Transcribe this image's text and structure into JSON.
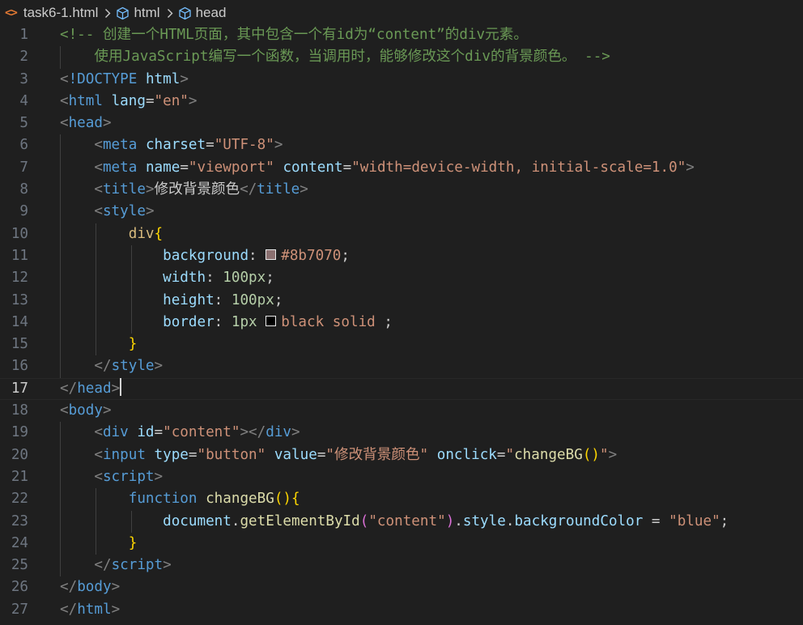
{
  "breadcrumb": {
    "file_icon": "<>",
    "file_name": "task6-1.html",
    "items": [
      "html",
      "head"
    ]
  },
  "icons": {
    "file": "html-file-icon",
    "element": "cube-icon",
    "separator": "chevron-right-icon"
  },
  "colors": {
    "background": "#1f1f1f",
    "swatch_rust": "#8b7070",
    "swatch_black": "#000000"
  },
  "editor": {
    "current_line": 17,
    "line_numbers": [
      "1",
      "2",
      "3",
      "4",
      "5",
      "6",
      "7",
      "8",
      "9",
      "10",
      "11",
      "12",
      "13",
      "14",
      "15",
      "16",
      "17",
      "18",
      "19",
      "20",
      "21",
      "22",
      "23",
      "24",
      "25",
      "26",
      "27"
    ],
    "lines": [
      [
        [
          "cm",
          "<!-- 创建一个HTML页面，其中包含一个有id为“content”的div元素。"
        ]
      ],
      [
        [
          "cm",
          "    使用JavaScript编写一个函数，当调用时，能够修改这个div的背景颜色。 -->"
        ]
      ],
      [
        [
          "br",
          "<"
        ],
        [
          "tag",
          "!DOCTYPE"
        ],
        [
          "text",
          " "
        ],
        [
          "attr",
          "html"
        ],
        [
          "br",
          ">"
        ]
      ],
      [
        [
          "br",
          "<"
        ],
        [
          "tag",
          "html"
        ],
        [
          "text",
          " "
        ],
        [
          "attr",
          "lang"
        ],
        [
          "text",
          "="
        ],
        [
          "str",
          "\"en\""
        ],
        [
          "br",
          ">"
        ]
      ],
      [
        [
          "br",
          "<"
        ],
        [
          "tag",
          "head"
        ],
        [
          "br",
          ">"
        ]
      ],
      [
        [
          "text",
          "    "
        ],
        [
          "br",
          "<"
        ],
        [
          "tag",
          "meta"
        ],
        [
          "text",
          " "
        ],
        [
          "attr",
          "charset"
        ],
        [
          "text",
          "="
        ],
        [
          "str",
          "\"UTF-8\""
        ],
        [
          "br",
          ">"
        ]
      ],
      [
        [
          "text",
          "    "
        ],
        [
          "br",
          "<"
        ],
        [
          "tag",
          "meta"
        ],
        [
          "text",
          " "
        ],
        [
          "attr",
          "name"
        ],
        [
          "text",
          "="
        ],
        [
          "str",
          "\"viewport\""
        ],
        [
          "text",
          " "
        ],
        [
          "attr",
          "content"
        ],
        [
          "text",
          "="
        ],
        [
          "str",
          "\"width=device-width, initial-scale=1.0\""
        ],
        [
          "br",
          ">"
        ]
      ],
      [
        [
          "text",
          "    "
        ],
        [
          "br",
          "<"
        ],
        [
          "tag",
          "title"
        ],
        [
          "br",
          ">"
        ],
        [
          "text",
          "修改背景颜色"
        ],
        [
          "br",
          "</"
        ],
        [
          "tag",
          "title"
        ],
        [
          "br",
          ">"
        ]
      ],
      [
        [
          "text",
          "    "
        ],
        [
          "br",
          "<"
        ],
        [
          "tag",
          "style"
        ],
        [
          "br",
          ">"
        ]
      ],
      [
        [
          "text",
          "        "
        ],
        [
          "sel",
          "div"
        ],
        [
          "b1",
          "{"
        ]
      ],
      [
        [
          "text",
          "            "
        ],
        [
          "prop",
          "background"
        ],
        [
          "text",
          ": "
        ],
        [
          "swatch",
          "#8b7070"
        ],
        [
          "str",
          "#8b7070"
        ],
        [
          "text",
          ";"
        ]
      ],
      [
        [
          "text",
          "            "
        ],
        [
          "prop",
          "width"
        ],
        [
          "text",
          ": "
        ],
        [
          "num",
          "100px"
        ],
        [
          "text",
          ";"
        ]
      ],
      [
        [
          "text",
          "            "
        ],
        [
          "prop",
          "height"
        ],
        [
          "text",
          ": "
        ],
        [
          "num",
          "100px"
        ],
        [
          "text",
          ";"
        ]
      ],
      [
        [
          "text",
          "            "
        ],
        [
          "prop",
          "border"
        ],
        [
          "text",
          ": "
        ],
        [
          "num",
          "1px"
        ],
        [
          "text",
          " "
        ],
        [
          "swatch",
          "#000000"
        ],
        [
          "str",
          "black"
        ],
        [
          "text",
          " "
        ],
        [
          "str",
          "solid"
        ],
        [
          "text",
          " ;"
        ]
      ],
      [
        [
          "text",
          "        "
        ],
        [
          "b1",
          "}"
        ]
      ],
      [
        [
          "text",
          "    "
        ],
        [
          "br",
          "</"
        ],
        [
          "tag",
          "style"
        ],
        [
          "br",
          ">"
        ]
      ],
      [
        [
          "br",
          "</"
        ],
        [
          "tag",
          "head"
        ],
        [
          "br",
          ">"
        ],
        [
          "cursor",
          ""
        ]
      ],
      [
        [
          "br",
          "<"
        ],
        [
          "tag",
          "body"
        ],
        [
          "br",
          ">"
        ]
      ],
      [
        [
          "text",
          "    "
        ],
        [
          "br",
          "<"
        ],
        [
          "tag",
          "div"
        ],
        [
          "text",
          " "
        ],
        [
          "attr",
          "id"
        ],
        [
          "text",
          "="
        ],
        [
          "str",
          "\"content\""
        ],
        [
          "br",
          "></"
        ],
        [
          "tag",
          "div"
        ],
        [
          "br",
          ">"
        ]
      ],
      [
        [
          "text",
          "    "
        ],
        [
          "br",
          "<"
        ],
        [
          "tag",
          "input"
        ],
        [
          "text",
          " "
        ],
        [
          "attr",
          "type"
        ],
        [
          "text",
          "="
        ],
        [
          "str",
          "\"button\""
        ],
        [
          "text",
          " "
        ],
        [
          "attr",
          "value"
        ],
        [
          "text",
          "="
        ],
        [
          "str",
          "\"修改背景颜色\""
        ],
        [
          "text",
          " "
        ],
        [
          "attr",
          "onclick"
        ],
        [
          "text",
          "="
        ],
        [
          "str",
          "\""
        ],
        [
          "fn",
          "changeBG"
        ],
        [
          "b1",
          "()"
        ],
        [
          "str",
          "\""
        ],
        [
          "br",
          ">"
        ]
      ],
      [
        [
          "text",
          "    "
        ],
        [
          "br",
          "<"
        ],
        [
          "tag",
          "script"
        ],
        [
          "br",
          ">"
        ]
      ],
      [
        [
          "text",
          "        "
        ],
        [
          "kw",
          "function"
        ],
        [
          "text",
          " "
        ],
        [
          "fn",
          "changeBG"
        ],
        [
          "b1",
          "(){"
        ]
      ],
      [
        [
          "text",
          "            "
        ],
        [
          "var",
          "document"
        ],
        [
          "text",
          "."
        ],
        [
          "fn",
          "getElementById"
        ],
        [
          "b2",
          "("
        ],
        [
          "str",
          "\"content\""
        ],
        [
          "b2",
          ")"
        ],
        [
          "text",
          "."
        ],
        [
          "var",
          "style"
        ],
        [
          "text",
          "."
        ],
        [
          "var",
          "backgroundColor"
        ],
        [
          "text",
          " = "
        ],
        [
          "str",
          "\"blue\""
        ],
        [
          "text",
          ";"
        ]
      ],
      [
        [
          "text",
          "        "
        ],
        [
          "b1",
          "}"
        ]
      ],
      [
        [
          "text",
          "    "
        ],
        [
          "br",
          "</"
        ],
        [
          "tag",
          "script"
        ],
        [
          "br",
          ">"
        ]
      ],
      [
        [
          "br",
          "</"
        ],
        [
          "tag",
          "body"
        ],
        [
          "br",
          ">"
        ]
      ],
      [
        [
          "br",
          "</"
        ],
        [
          "tag",
          "html"
        ],
        [
          "br",
          ">"
        ]
      ]
    ]
  }
}
